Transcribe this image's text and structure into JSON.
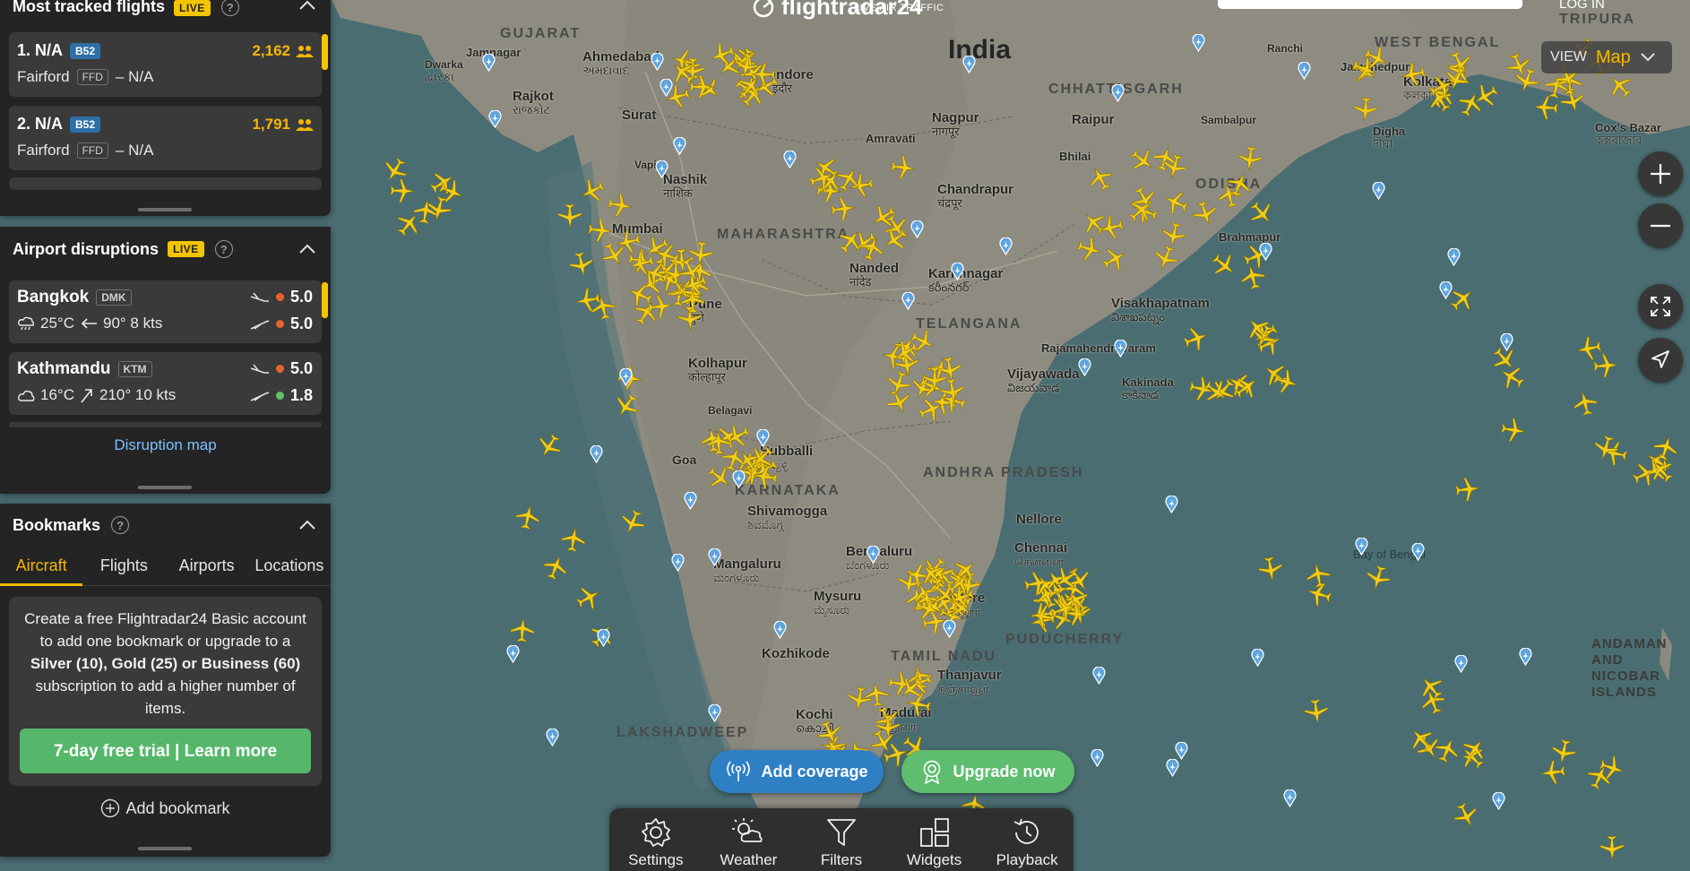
{
  "header": {
    "logo_text": "flightradar24",
    "logo_subtitle": "LIVE AIR TRAFFIC",
    "login_label": "LOG IN"
  },
  "view_selector": {
    "label": "VIEW",
    "value": "Map"
  },
  "most_tracked": {
    "title": "Most tracked flights",
    "live_label": "LIVE",
    "help": "?",
    "flights": [
      {
        "rank_callsign": "1. N/A",
        "type": "B52",
        "count": "2,162",
        "origin": "Fairford",
        "origin_code": "FFD",
        "destination": "– N/A"
      },
      {
        "rank_callsign": "2. N/A",
        "type": "B52",
        "count": "1,791",
        "origin": "Fairford",
        "origin_code": "FFD",
        "destination": "– N/A"
      }
    ]
  },
  "airport_disruptions": {
    "title": "Airport disruptions",
    "live_label": "LIVE",
    "help": "?",
    "airports": [
      {
        "name": "Bangkok",
        "code": "DMK",
        "temp": "25°C",
        "wind": "90° 8 kts",
        "arr_score": "5.0",
        "dep_score": "5.0",
        "arr_color": "#e8632b",
        "dep_color": "#e8632b"
      },
      {
        "name": "Kathmandu",
        "code": "KTM",
        "temp": "16°C",
        "wind": "210° 10 kts",
        "arr_score": "5.0",
        "dep_score": "1.8",
        "arr_color": "#e8632b",
        "dep_color": "#5ec26a"
      }
    ],
    "link_label": "Disruption map"
  },
  "bookmarks": {
    "title": "Bookmarks",
    "help": "?",
    "tabs": [
      "Aircraft",
      "Flights",
      "Airports",
      "Locations"
    ],
    "active_tab": "Aircraft",
    "promo_text_1": "Create a free Flightradar24 Basic account to add one bookmark or upgrade to a ",
    "promo_bold_1": "Silver (10), Gold (25) or Business (60)",
    "promo_text_2": " subscription to add a higher number of items.",
    "trial_button": "7-day free trial | Learn more",
    "add_bookmark": "Add bookmark"
  },
  "action_pills": {
    "coverage": "Add coverage",
    "upgrade": "Upgrade now"
  },
  "toolbar": {
    "items": [
      {
        "label": "Settings",
        "icon": "gear-icon"
      },
      {
        "label": "Weather",
        "icon": "weather-icon"
      },
      {
        "label": "Filters",
        "icon": "filter-icon"
      },
      {
        "label": "Widgets",
        "icon": "widgets-icon"
      },
      {
        "label": "Playback",
        "icon": "history-icon"
      }
    ]
  },
  "map_labels": {
    "country": "India",
    "states": [
      "GUJARAT",
      "MAHARASHTRA",
      "TELANGANA",
      "ANDHRA PRADESH",
      "KARNATAKA",
      "TAMIL NADU",
      "ODISHA",
      "CHHATTISGARH",
      "LAKSHADWEEP",
      "PUDUCHERRY",
      "WEST BENGAL",
      "TRIPURA"
    ],
    "cities": [
      {
        "name": "Ahmedabad",
        "sub": "અમદાવાદ"
      },
      {
        "name": "Indore",
        "sub": "इंदौर"
      },
      {
        "name": "Rajkot",
        "sub": "રાજકોટ"
      },
      {
        "name": "Surat",
        "sub": ""
      },
      {
        "name": "Nagpur",
        "sub": "नागपूर"
      },
      {
        "name": "Raipur",
        "sub": ""
      },
      {
        "name": "Nashik",
        "sub": "नाशिक"
      },
      {
        "name": "Mumbai",
        "sub": ""
      },
      {
        "name": "Pune",
        "sub": "पुणे"
      },
      {
        "name": "Nanded",
        "sub": "नांदेड"
      },
      {
        "name": "Chandrapur",
        "sub": "चंद्रपूर"
      },
      {
        "name": "Karimnagar",
        "sub": "కరీంనగర్"
      },
      {
        "name": "Visakhapatnam",
        "sub": "విశాఖపట్నం"
      },
      {
        "name": "Vijayawada",
        "sub": "విజయవాడ"
      },
      {
        "name": "Kolhapur",
        "sub": "कोल्हापूर"
      },
      {
        "name": "Hubballi",
        "sub": "ಹುಬ್ಬಳ್ಳಿ"
      },
      {
        "name": "Shivamogga",
        "sub": "ಶಿವಮೊಗ್ಗ"
      },
      {
        "name": "Bengaluru",
        "sub": "ಬೆಂಗಳೂರು"
      },
      {
        "name": "Chennai",
        "sub": "சென்னை"
      },
      {
        "name": "Mangaluru",
        "sub": "ಮಂಗಳೂರು"
      },
      {
        "name": "Mysuru",
        "sub": "ಮೈಸೂರು"
      },
      {
        "name": "Vellore",
        "sub": "வேலூர்"
      },
      {
        "name": "Nellore",
        "sub": ""
      },
      {
        "name": "Kozhikode",
        "sub": ""
      },
      {
        "name": "Thanjavur",
        "sub": "தஞ்சாவூர்"
      },
      {
        "name": "Madurai",
        "sub": "மதுரை"
      },
      {
        "name": "Kochi",
        "sub": "കൊച്ചി"
      },
      {
        "name": "Kolkata",
        "sub": "কলকাতা"
      },
      {
        "name": "Jamshedpur",
        "sub": ""
      },
      {
        "name": "Brahmapur",
        "sub": ""
      },
      {
        "name": "Kakinada",
        "sub": "కాకినాడ"
      },
      {
        "name": "Rajamahendravaram",
        "sub": ""
      },
      {
        "name": "Cox's Bazar",
        "sub": "কক্সবাজার"
      },
      {
        "name": "Digha",
        "sub": "দীঘা"
      },
      {
        "name": "Dwarka",
        "sub": "દ્વારકા"
      },
      {
        "name": "Jamnagar",
        "sub": ""
      },
      {
        "name": "Vapi",
        "sub": ""
      },
      {
        "name": "Goa",
        "sub": ""
      },
      {
        "name": "Belagavi",
        "sub": ""
      },
      {
        "name": "Amravati",
        "sub": ""
      },
      {
        "name": "Sambalpur",
        "sub": ""
      },
      {
        "name": "Bhilai",
        "sub": ""
      },
      {
        "name": "Ranchi",
        "sub": ""
      }
    ],
    "sea": "Bay of Bengal",
    "islands": "ANDAMAN AND NICOBAR ISLANDS"
  },
  "colors": {
    "accent": "#f5b800",
    "sea": "#496d72",
    "land": "#8c8a80",
    "panel": "#242424",
    "card": "#3a3a3a",
    "link": "#7cc1ff"
  }
}
